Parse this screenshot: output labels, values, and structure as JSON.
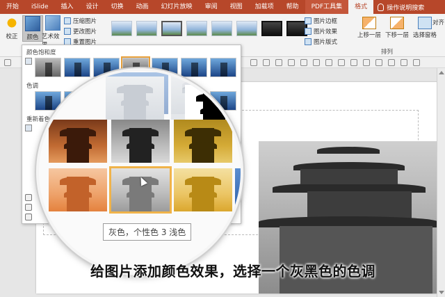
{
  "tabs": [
    {
      "label": "开始"
    },
    {
      "label": "iSlide"
    },
    {
      "label": "插入"
    },
    {
      "label": "设计"
    },
    {
      "label": "切换"
    },
    {
      "label": "动画"
    },
    {
      "label": "幻灯片放映"
    },
    {
      "label": "审阅"
    },
    {
      "label": "视图"
    },
    {
      "label": "加载项"
    },
    {
      "label": "帮助"
    },
    {
      "label": "PDF工具集"
    },
    {
      "label": "格式"
    }
  ],
  "tell_me": "操作说明搜索",
  "ribbon": {
    "correct": "校正",
    "color": "颜色",
    "artistic": "艺术效果",
    "compress": "压缩图片",
    "change": "更改图片",
    "reset": "重置图片",
    "border": "图片边框",
    "effect": "图片效果",
    "layout": "图片版式",
    "bring_forward": "上移一层",
    "send_backward": "下移一层",
    "selection_pane": "选择窗格",
    "align": "对齐",
    "arrange_group": "排列"
  },
  "panel": {
    "saturation": "颜色饱和度",
    "tone": "色调",
    "recolor": "重新着色"
  },
  "tooltip": "灰色，个性色 3 浅色",
  "caption": "给图片添加颜色效果，选择一个灰黑色的色调",
  "colors": {
    "accent": "#b7472a",
    "hover": "#f0b34a"
  }
}
